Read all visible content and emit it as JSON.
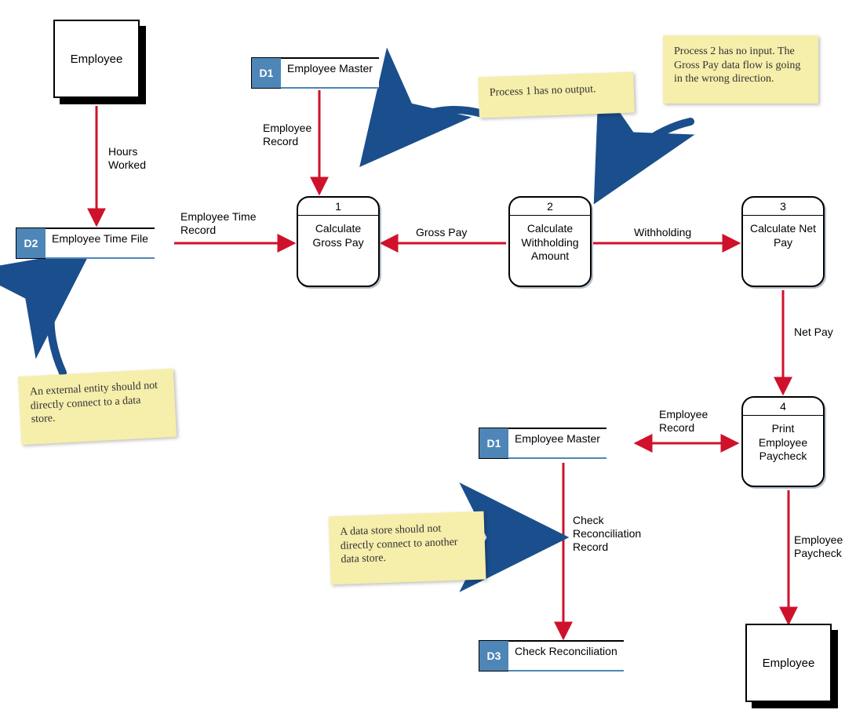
{
  "entities": {
    "employee_top": "Employee",
    "employee_bottom": "Employee"
  },
  "datastores": {
    "d1a": {
      "id": "D1",
      "name": "Employee Master"
    },
    "d2": {
      "id": "D2",
      "name": "Employee Time File"
    },
    "d1b": {
      "id": "D1",
      "name": "Employee Master"
    },
    "d3": {
      "id": "D3",
      "name": "Check Reconciliation"
    }
  },
  "processes": {
    "p1": {
      "num": "1",
      "name": "Calculate Gross Pay"
    },
    "p2": {
      "num": "2",
      "name": "Calculate Withholding Amount"
    },
    "p3": {
      "num": "3",
      "name": "Calculate Net Pay"
    },
    "p4": {
      "num": "4",
      "name": "Print Employee Paycheck"
    }
  },
  "flows": {
    "hours_worked": "Hours Worked",
    "employee_time_record": "Employee Time Record",
    "employee_record_top": "Employee Record",
    "gross_pay": "Gross Pay",
    "withholding": "Withholding",
    "net_pay": "Net Pay",
    "employee_record_right": "Employee Record",
    "check_recon_record": "Check Reconciliation Record",
    "employee_paycheck": "Employee Paycheck"
  },
  "notes": {
    "n1": "Process 1 has no output.",
    "n2": "Process 2 has no input. The Gross Pay data flow is going in the wrong direction.",
    "n3": "An external entity should not directly connect to a data store.",
    "n4": "A data store should not directly connect to another data store."
  },
  "colors": {
    "flow_arrow": "#d0112b",
    "note_arrow": "#1a4e8c",
    "datastore_blue": "#4e86b7",
    "sticky_bg": "#f6eeab"
  }
}
